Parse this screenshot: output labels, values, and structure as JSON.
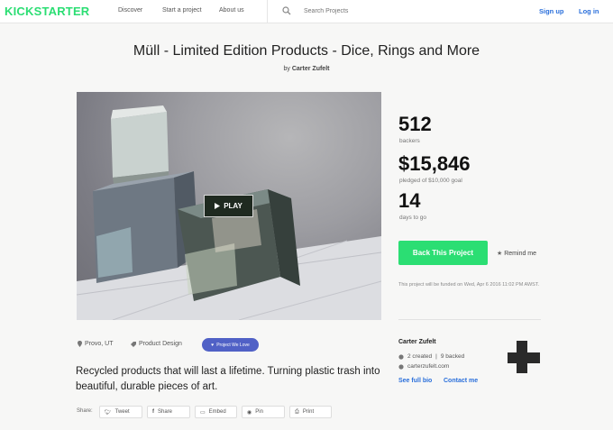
{
  "nav": {
    "logo": "KICKSTARTER",
    "links": [
      "Discover",
      "Start a project",
      "About us"
    ],
    "search_placeholder": "Search Projects",
    "sign_up": "Sign up",
    "log_in": "Log in"
  },
  "project": {
    "title": "Müll - Limited Edition Products - Dice, Rings and More",
    "by_prefix": "by",
    "creator": "Carter Zufelt",
    "play_label": "PLAY",
    "blurb": "Recycled products that will last a lifetime. Turning plastic trash into beautiful, durable pieces of art.",
    "location": "Provo, UT",
    "category": "Product Design",
    "badge": "Project We Love"
  },
  "stats": {
    "backers": "512",
    "backers_label": "backers",
    "pledged": "$15,846",
    "pledged_label": "pledged of $10,000 goal",
    "days": "14",
    "days_label": "days to go"
  },
  "actions": {
    "back_label": "Back This Project",
    "remind_label": "Remind me",
    "fine_print": "This project will be funded on Wed, Apr 6 2016 11:02 PM AWST."
  },
  "creator_box": {
    "name": "Carter Zufelt",
    "created": "2 created",
    "backed": "9 backed",
    "website": "carterzufelt.com",
    "see_bio": "See full bio",
    "contact": "Contact me"
  },
  "share": {
    "label": "Share:",
    "buttons": [
      "Tweet",
      "Share",
      "Embed",
      "Pin",
      "Print"
    ]
  },
  "colors": {
    "brand_green": "#2bde73",
    "link_blue": "#2a6fdb",
    "badge_purple": "#5061c6"
  }
}
